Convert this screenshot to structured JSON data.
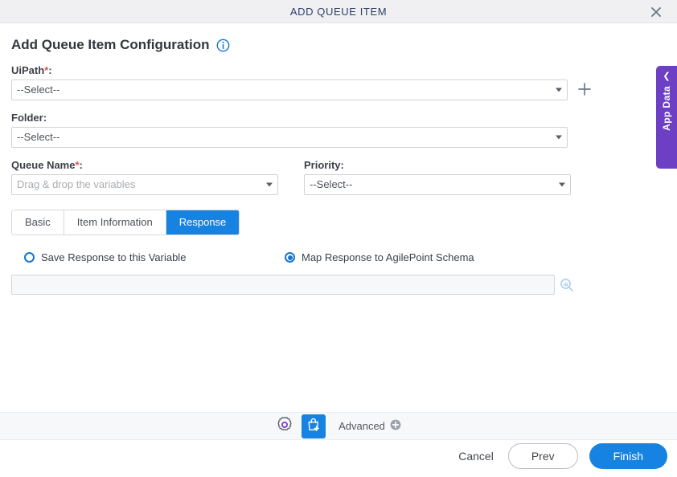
{
  "window": {
    "title": "ADD QUEUE ITEM",
    "close_icon": "close-icon"
  },
  "page": {
    "title": "Add Queue Item Configuration",
    "info_icon": "info-icon"
  },
  "fields": {
    "uipath": {
      "label": "UiPath",
      "required_marker": "*",
      "suffix": ":",
      "value": "--Select--",
      "add_icon": "plus-icon"
    },
    "folder": {
      "label": "Folder",
      "suffix": ":",
      "value": "--Select--"
    },
    "queue_name": {
      "label": "Queue Name",
      "required_marker": "*",
      "suffix": ":",
      "placeholder": "Drag & drop the variables",
      "value": ""
    },
    "priority": {
      "label": "Priority",
      "suffix": ":",
      "value": "--Select--"
    }
  },
  "tabs": [
    {
      "label": "Basic",
      "active": false
    },
    {
      "label": "Item Information",
      "active": false
    },
    {
      "label": "Response",
      "active": true
    }
  ],
  "response": {
    "radio_save": {
      "label": "Save Response to this Variable",
      "selected": false
    },
    "radio_map": {
      "label": "Map Response to AgilePoint Schema",
      "selected": true
    },
    "schema_input": {
      "value": "",
      "placeholder": ""
    },
    "lookup_icon": "search-icon"
  },
  "toolbar": {
    "gear_icon": "gear-icon",
    "bag_icon": "add-queue-item-icon",
    "advanced_label": "Advanced",
    "advanced_icon": "plus-circle-icon"
  },
  "footer": {
    "cancel_label": "Cancel",
    "prev_label": "Prev",
    "finish_label": "Finish"
  },
  "app_data_tab": {
    "label": "App Data",
    "chevron_icon": "chevron-left-icon"
  },
  "colors": {
    "accent_blue": "#1683e2",
    "purple": "#6c3fc5",
    "required_red": "#d9534f",
    "title_navy": "#2d3e67"
  }
}
